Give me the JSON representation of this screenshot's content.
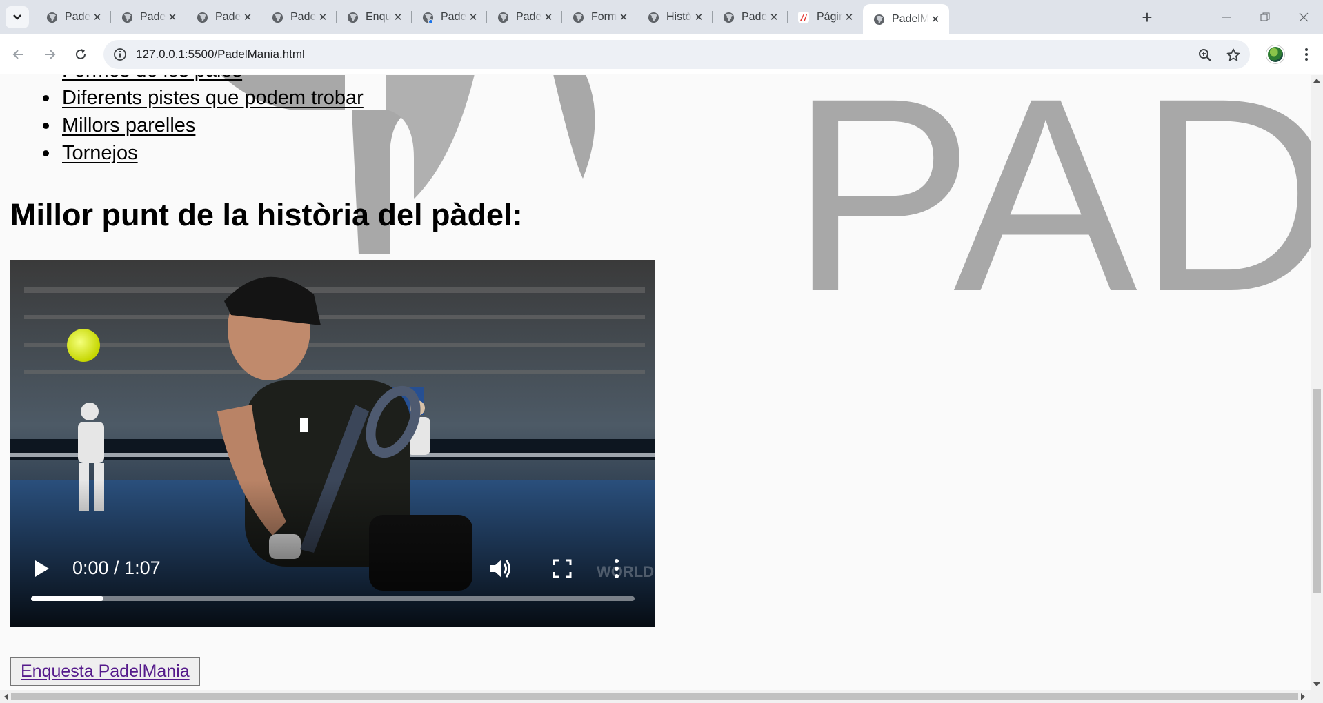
{
  "browser": {
    "tabs": [
      {
        "title": "PadelMania",
        "favicon": "globe-icon",
        "active": false,
        "loading": false
      },
      {
        "title": "PadelMania",
        "favicon": "globe-icon",
        "active": false,
        "loading": false
      },
      {
        "title": "PadelMania",
        "favicon": "globe-icon",
        "active": false,
        "loading": false
      },
      {
        "title": "PadelMania",
        "favicon": "globe-icon",
        "active": false,
        "loading": false
      },
      {
        "title": "Enquesta",
        "favicon": "globe-icon",
        "active": false,
        "loading": false
      },
      {
        "title": "PadelMania",
        "favicon": "globe-icon",
        "active": false,
        "loading": true
      },
      {
        "title": "PadelMania",
        "favicon": "globe-icon",
        "active": false,
        "loading": false
      },
      {
        "title": "Formes",
        "favicon": "globe-icon",
        "active": false,
        "loading": false
      },
      {
        "title": "Història",
        "favicon": "globe-icon",
        "active": false,
        "loading": false
      },
      {
        "title": "PadelMania",
        "favicon": "globe-icon",
        "active": false,
        "loading": false
      },
      {
        "title": "Página",
        "favicon": "laliga-icon",
        "active": false,
        "loading": false
      },
      {
        "title": "PadelMania",
        "favicon": "globe-icon",
        "active": true,
        "loading": false
      }
    ],
    "address_url": "127.0.0.1:5500/PadelMania.html",
    "colors": {
      "tabstrip": "#dfe3ea",
      "toolbar": "#ffffff",
      "omnibox": "#edf0f5",
      "loading_dot": "#1a73e8"
    }
  },
  "page": {
    "nav_links": [
      "Formes de les pales",
      "Diferents pistes que podem trobar",
      "Millors parelles",
      "Tornejos"
    ],
    "heading": "Millor punt de la història del pàdel:",
    "video": {
      "current_time": "0:00",
      "duration": "1:07",
      "time_display": "0:00 / 1:07",
      "progress_buffered_fraction": 0.12,
      "watermark": "WORLD PADEL"
    },
    "survey_link": "Enquesta PadelMania",
    "background_logo_text": "PAD"
  }
}
